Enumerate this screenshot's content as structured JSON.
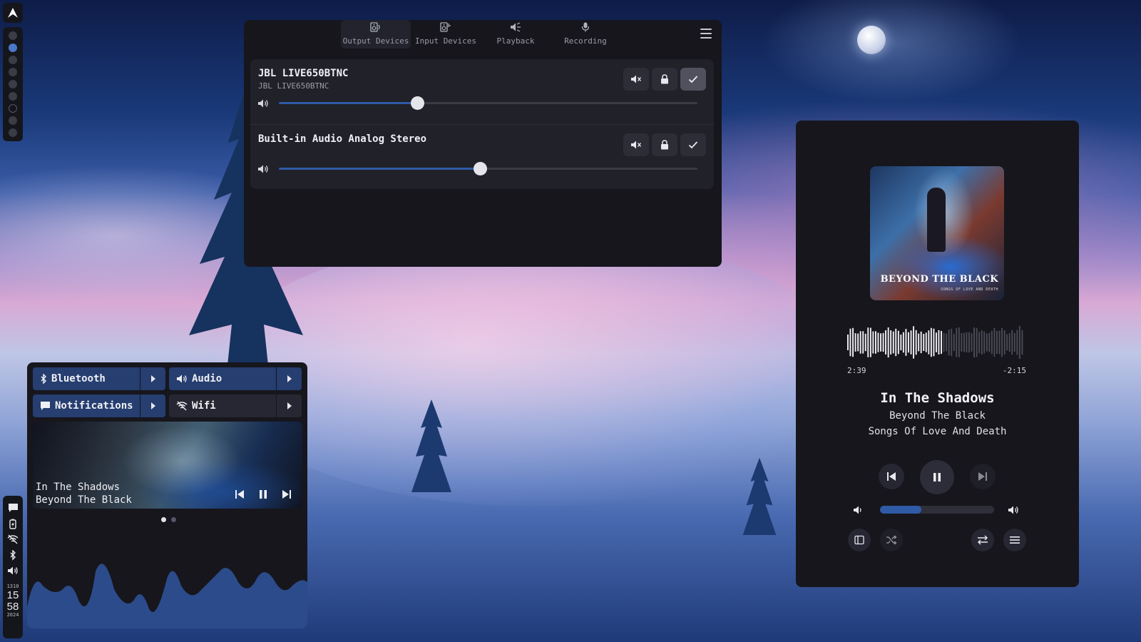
{
  "theme": {
    "panel_bg": "#16161c",
    "card_bg": "#202129",
    "accent": "#2f5aa6",
    "tile_active": "#263e70"
  },
  "launcher": {
    "icon": "arch-logo-icon"
  },
  "workspaces": {
    "count": 9,
    "active_index": 1
  },
  "audio_window": {
    "tabs": [
      {
        "label": "Output Devices",
        "icon": "speaker-icon",
        "active": true
      },
      {
        "label": "Input Devices",
        "icon": "microphone-input-icon",
        "active": false
      },
      {
        "label": "Playback",
        "icon": "playback-icon",
        "active": false
      },
      {
        "label": "Recording",
        "icon": "microphone-icon",
        "active": false
      }
    ],
    "devices": [
      {
        "name": "JBL LIVE650BTNC",
        "subtitle": "JBL LIVE650BTNC",
        "volume": 0.33,
        "default": true
      },
      {
        "name": "Built-in Audio Analog Stereo",
        "subtitle": "",
        "volume": 0.48,
        "default": false
      }
    ]
  },
  "player": {
    "album_art_title": "BEYOND THE BLACK",
    "album_art_subtitle": "SONGS OF LOVE AND DEATH",
    "elapsed": "2:39",
    "remaining": "-2:15",
    "progress": 0.54,
    "title": "In The Shadows",
    "artist": "Beyond The Black",
    "album": "Songs Of Love And Death",
    "volume": 0.36
  },
  "control_center": {
    "tiles": [
      {
        "label": "Bluetooth",
        "icon": "bluetooth-icon",
        "active": true
      },
      {
        "label": "Audio",
        "icon": "volume-icon",
        "active": true
      },
      {
        "label": "Notifications",
        "icon": "chat-bubble-icon",
        "active": true
      },
      {
        "label": "Wifi",
        "icon": "wifi-off-icon",
        "active": false
      }
    ],
    "media": {
      "title": "In The Shadows",
      "artist": "Beyond The Black"
    },
    "pager": {
      "pages": 2,
      "current": 0
    }
  },
  "tray": {
    "icons": [
      "notification-icon",
      "battery-charging-icon",
      "wifi-off-icon",
      "bluetooth-icon",
      "volume-icon"
    ],
    "clock": {
      "date_top": "1310",
      "hour": "15",
      "minute": "58",
      "year": "2024"
    }
  }
}
